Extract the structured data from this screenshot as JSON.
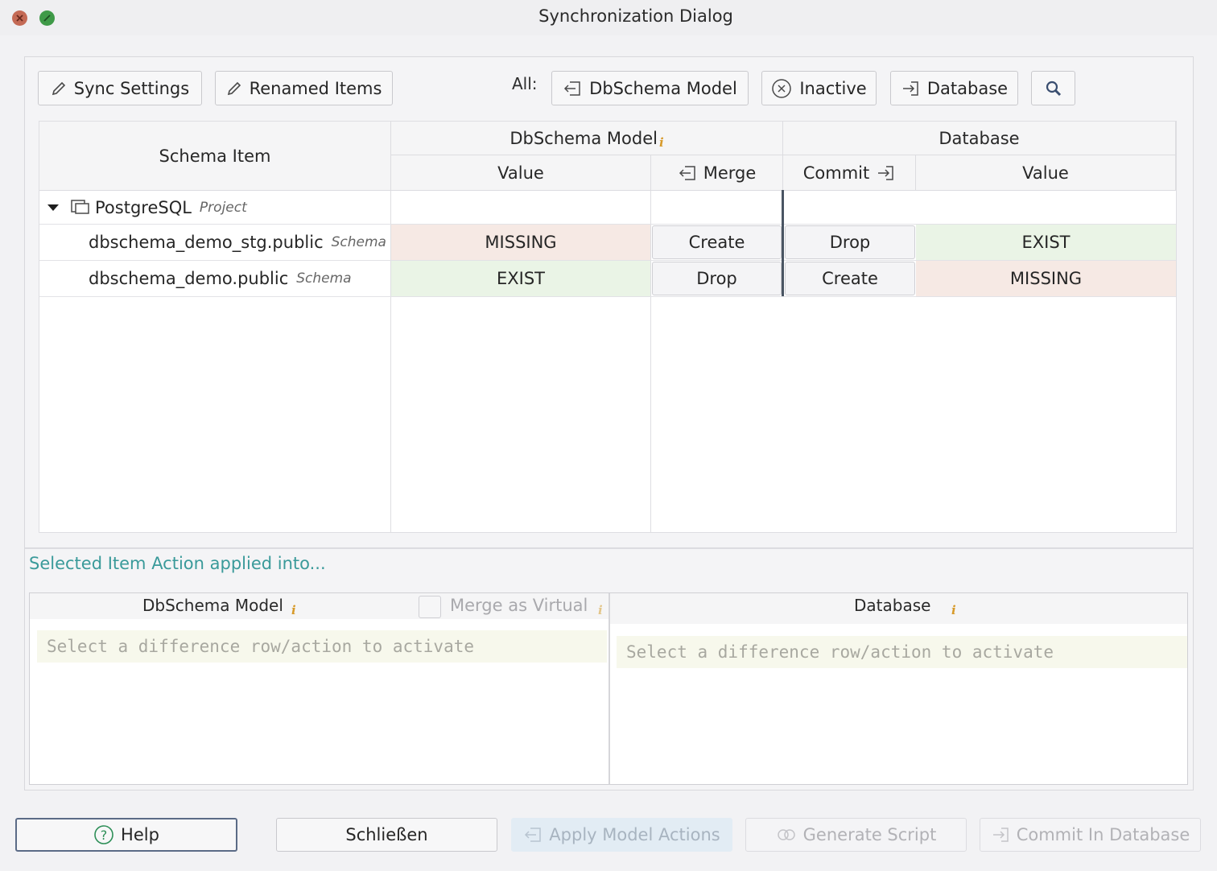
{
  "window": {
    "title": "Synchronization Dialog"
  },
  "toolbar": {
    "sync_settings": "Sync Settings",
    "renamed_items": "Renamed Items",
    "all_label": "All:",
    "dbschema_model": "DbSchema Model",
    "inactive": "Inactive",
    "database": "Database"
  },
  "grid": {
    "headers": {
      "schema_item": "Schema Item",
      "dbschema_model": "DbSchema Model",
      "database": "Database",
      "value_left": "Value",
      "merge": "Merge",
      "commit": "Commit",
      "value_right": "Value"
    },
    "project": {
      "name": "PostgreSQL",
      "type": "Project"
    },
    "rows": [
      {
        "name": "dbschema_demo_stg.public",
        "type": "Schema",
        "model_value": "MISSING",
        "merge_action": "Create",
        "commit_action": "Drop",
        "db_value": "EXIST"
      },
      {
        "name": "dbschema_demo.public",
        "type": "Schema",
        "model_value": "EXIST",
        "merge_action": "Drop",
        "commit_action": "Create",
        "db_value": "MISSING"
      }
    ]
  },
  "selected": {
    "section_label": "Selected Item Action applied into...",
    "model_title": "DbSchema Model",
    "merge_virtual": "Merge as Virtual",
    "database_title": "Database",
    "placeholder_left": "Select a difference row/action to activate",
    "placeholder_right": "Select a difference row/action to activate"
  },
  "footer": {
    "help": "Help",
    "close": "Schließen",
    "apply": "Apply Model Actions",
    "generate": "Generate Script",
    "commit": "Commit In Database"
  },
  "colors": {
    "missing_bg": "#f6e9e4",
    "exist_bg": "#eaf4e6",
    "section_label": "#3a9a9a",
    "info_icon": "#d79a2a"
  }
}
